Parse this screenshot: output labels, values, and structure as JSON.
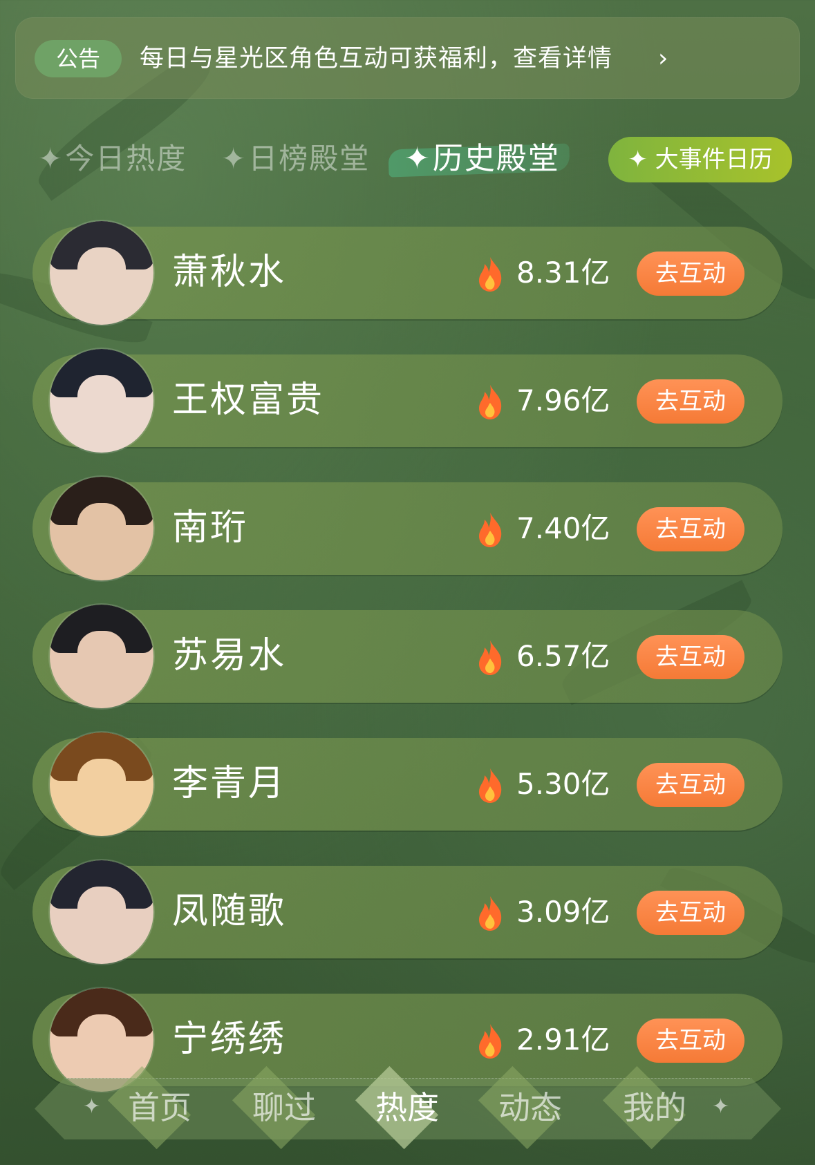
{
  "announcement": {
    "badge": "公告",
    "text": "每日与星光区角色互动可获福利，查看详情",
    "chevron": "›"
  },
  "tabs": [
    {
      "label": "今日热度",
      "active": false
    },
    {
      "label": "日榜殿堂",
      "active": false
    },
    {
      "label": "历史殿堂",
      "active": true
    }
  ],
  "tab_star": "✦",
  "calendar_button": {
    "label": "✦ 大事件日历"
  },
  "ranking": [
    {
      "name": "萧秋水",
      "heat": "8.31亿",
      "action": "去互动",
      "avatar": "avatar-xiao-qiushui"
    },
    {
      "name": "王权富贵",
      "heat": "7.96亿",
      "action": "去互动",
      "avatar": "avatar-wangquan-fugui"
    },
    {
      "name": "南珩",
      "heat": "7.40亿",
      "action": "去互动",
      "avatar": "avatar-nan-heng"
    },
    {
      "name": "苏易水",
      "heat": "6.57亿",
      "action": "去互动",
      "avatar": "avatar-su-yishui"
    },
    {
      "name": "李青月",
      "heat": "5.30亿",
      "action": "去互动",
      "avatar": "avatar-li-qingyue"
    },
    {
      "name": "凤随歌",
      "heat": "3.09亿",
      "action": "去互动",
      "avatar": "avatar-feng-suige"
    },
    {
      "name": "宁绣绣",
      "heat": "2.91亿",
      "action": "去互动",
      "avatar": "avatar-ning-xiuxiu"
    }
  ],
  "nav": {
    "items": [
      {
        "label": "首页",
        "active": false
      },
      {
        "label": "聊过",
        "active": false
      },
      {
        "label": "热度",
        "active": true
      },
      {
        "label": "动态",
        "active": false
      },
      {
        "label": "我的",
        "active": false
      }
    ],
    "spark": "✦"
  },
  "colors": {
    "accent_orange": "#f57a36",
    "calendar_green": "#8fbb38",
    "badge_green": "#6fa266"
  }
}
